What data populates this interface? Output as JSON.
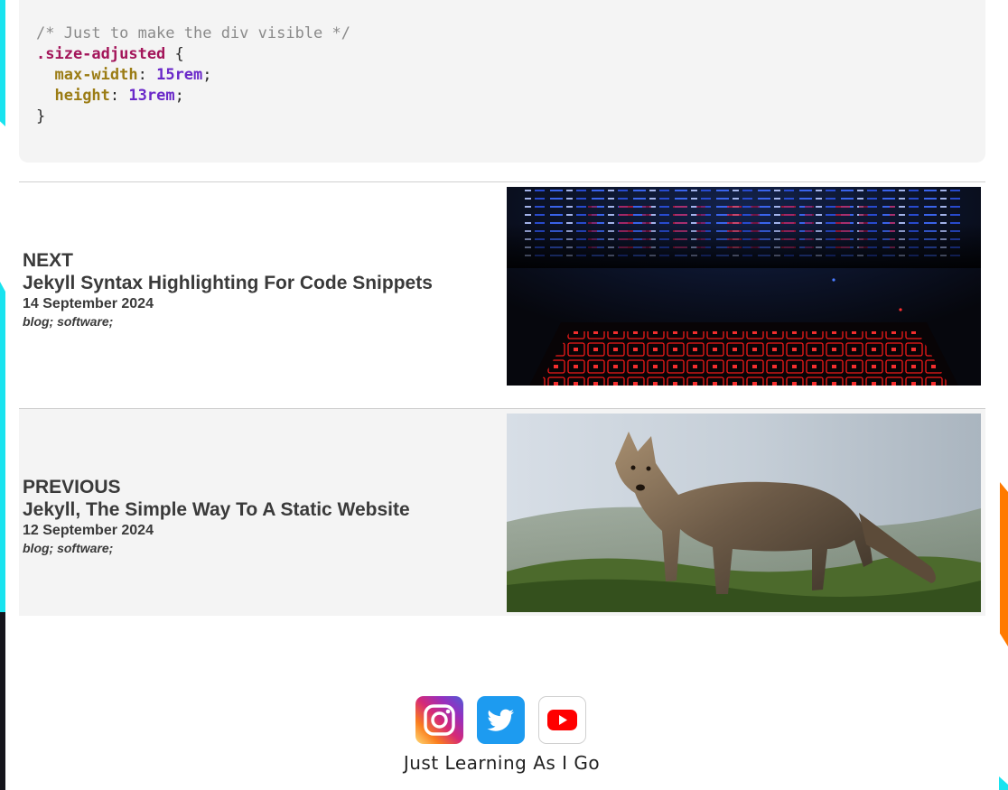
{
  "code": {
    "brace_close_top": "}",
    "comment": "/* Just to make the div visible */",
    "selector": ".size-adjusted",
    "open_brace": " {",
    "decls": [
      {
        "prop": "max-width",
        "value": "15rem"
      },
      {
        "prop": "height",
        "value": "13rem"
      }
    ],
    "brace_close": "}"
  },
  "next_post": {
    "kind": "NEXT",
    "title": "Jekyll Syntax Highlighting For Code Snippets",
    "date": "14 September 2024",
    "tags": "blog; software;",
    "thumbnail": "laptop-keyboard-code-image"
  },
  "previous_post": {
    "kind": "PREVIOUS",
    "title": "Jekyll, The Simple Way To A Static Website",
    "date": "12 September 2024",
    "tags": "blog; software;",
    "thumbnail": "coyote-image"
  },
  "footer": {
    "social": [
      {
        "name": "instagram",
        "icon": "instagram-icon"
      },
      {
        "name": "twitter",
        "icon": "twitter-icon"
      },
      {
        "name": "youtube",
        "icon": "youtube-icon"
      }
    ],
    "tagline": "Just Learning As I Go"
  },
  "colors": {
    "accent_cyan": "#19e3ef",
    "accent_orange": "#ff7a00",
    "twitter_blue": "#1d9bf0",
    "youtube_red": "#ff0000"
  }
}
